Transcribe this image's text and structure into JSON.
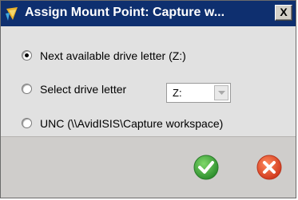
{
  "window": {
    "title": "Assign Mount Point: Capture w...",
    "close_label": "X",
    "app_icon": "avid-app-icon"
  },
  "options": [
    {
      "label": "Next available drive letter (Z:)",
      "selected": true
    },
    {
      "label": "Select drive letter",
      "selected": false
    },
    {
      "label": "UNC (\\\\AvidISIS\\Capture workspace)",
      "selected": false
    }
  ],
  "drive_select": {
    "value": "Z:",
    "enabled": false
  },
  "buttons": {
    "ok_icon": "checkmark-icon",
    "cancel_icon": "x-icon"
  },
  "colors": {
    "titlebar": "#0e2f6f",
    "ok_green": "#3aa53a",
    "cancel_red": "#e2442a"
  }
}
